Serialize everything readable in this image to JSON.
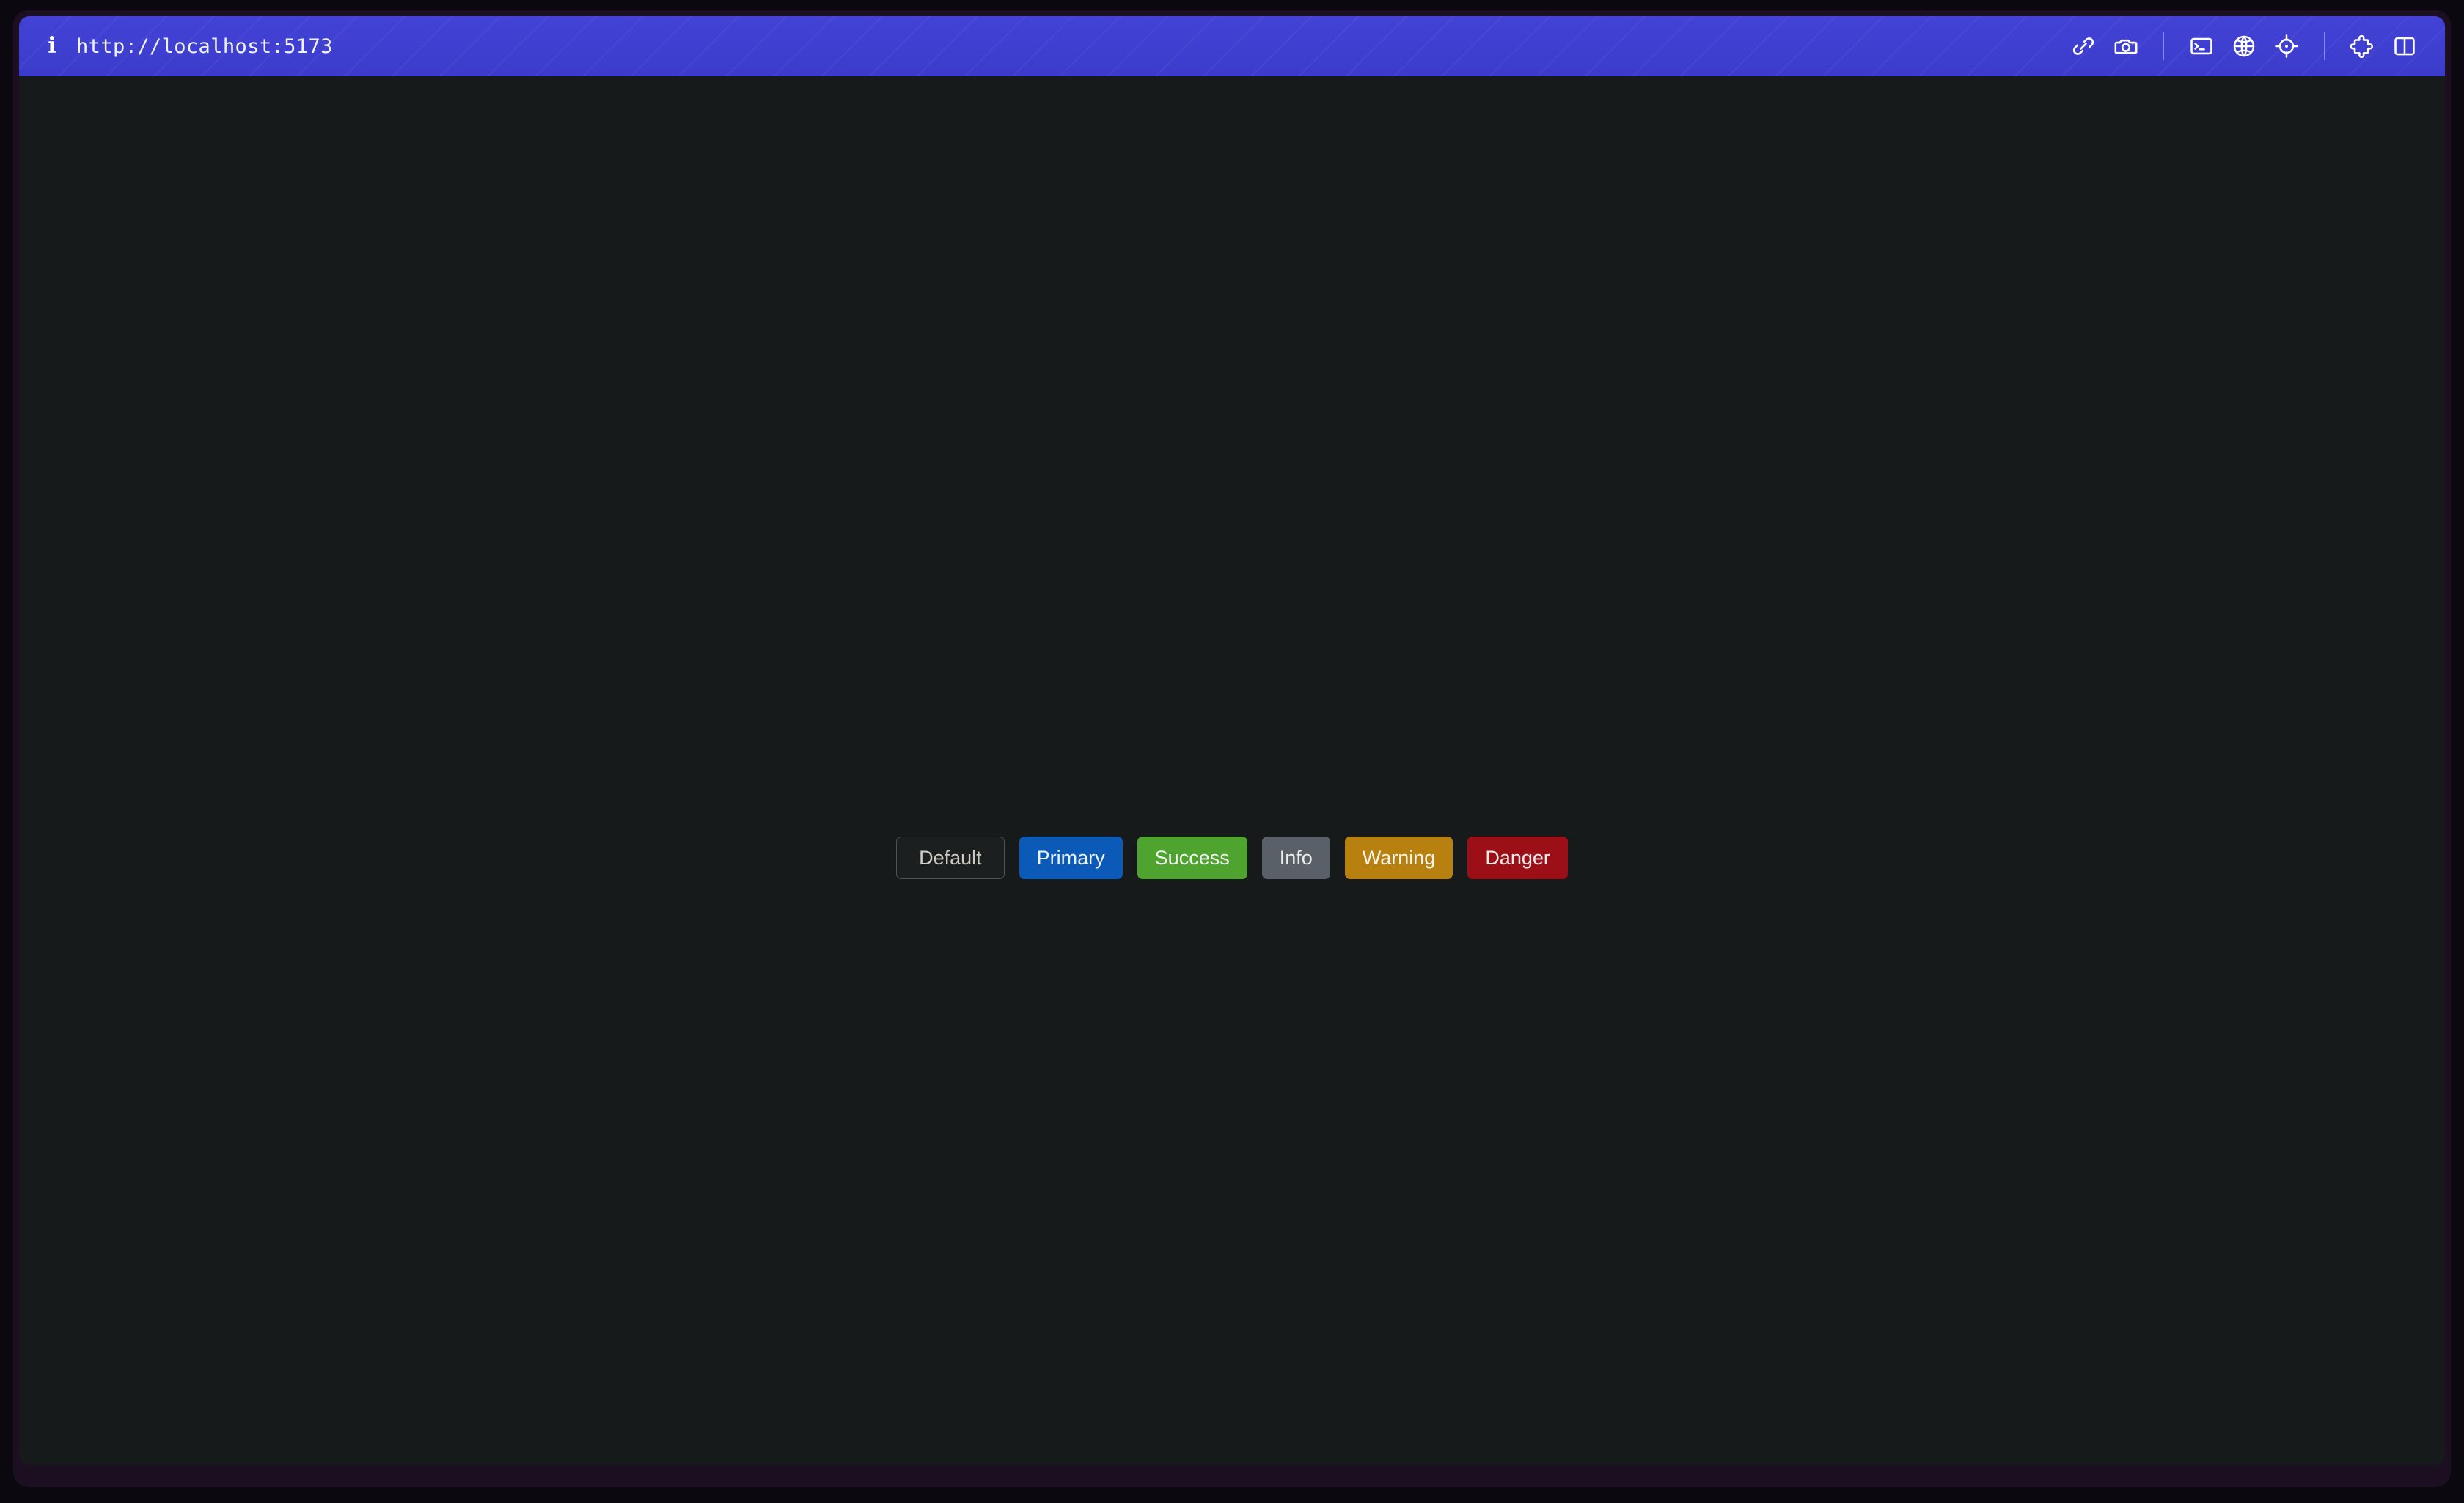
{
  "browser": {
    "info_icon_glyph": "i",
    "info_icon_name": "info-icon",
    "url": "http://localhost:5173",
    "toolbar_icons": [
      {
        "name": "link-icon",
        "label": "Copy link"
      },
      {
        "name": "camera-icon",
        "label": "Screenshot"
      },
      {
        "name": "separator",
        "label": ""
      },
      {
        "name": "terminal-icon",
        "label": "Console"
      },
      {
        "name": "globe-icon",
        "label": "Network"
      },
      {
        "name": "crosshair-icon",
        "label": "Inspect element"
      },
      {
        "name": "separator",
        "label": ""
      },
      {
        "name": "puzzle-piece-icon",
        "label": "Extensions"
      },
      {
        "name": "split-panel-icon",
        "label": "Toggle panel"
      }
    ]
  },
  "page": {
    "background_color": "#171a1b",
    "buttons": [
      {
        "label": "Default",
        "variant": "default",
        "color": "#1c1f20"
      },
      {
        "label": "Primary",
        "variant": "primary",
        "color": "#0b5ab8"
      },
      {
        "label": "Success",
        "variant": "success",
        "color": "#4fa32f"
      },
      {
        "label": "Info",
        "variant": "info",
        "color": "#5a6067"
      },
      {
        "label": "Warning",
        "variant": "warning",
        "color": "#b8800f"
      },
      {
        "label": "Danger",
        "variant": "danger",
        "color": "#9d0f16"
      }
    ]
  }
}
